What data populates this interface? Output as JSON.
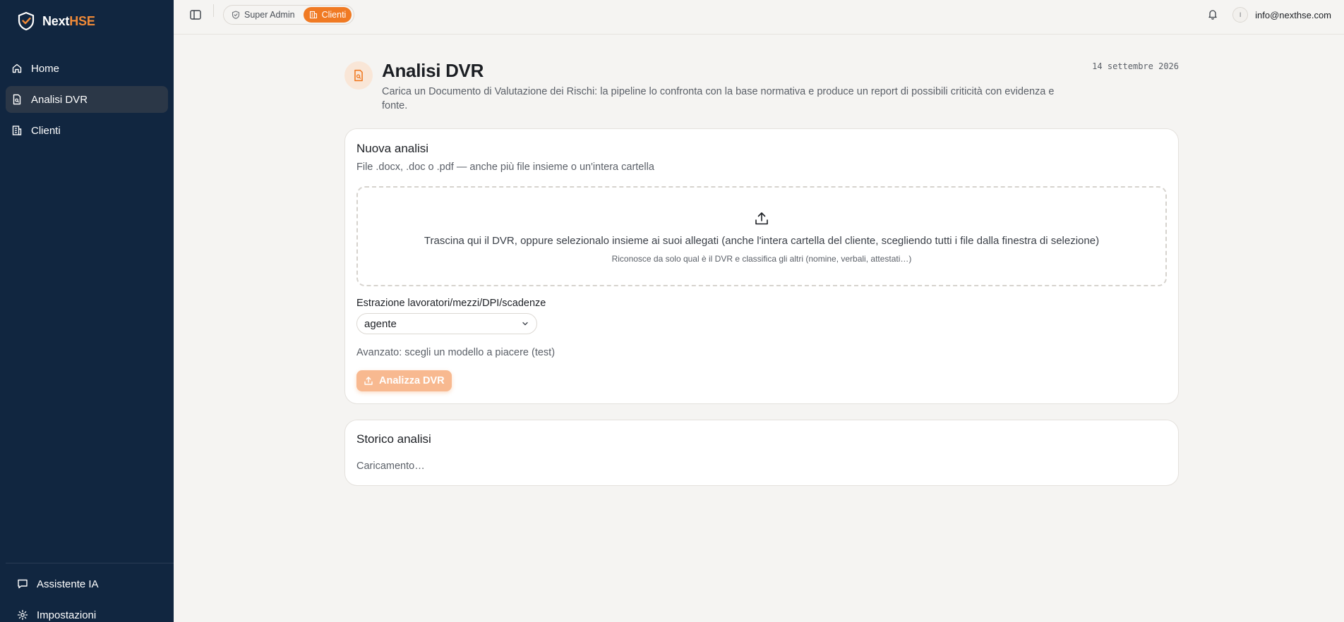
{
  "brand": {
    "name_part1": "Next",
    "name_part2": "HSE"
  },
  "sidebar": {
    "items": [
      {
        "label": "Home",
        "icon": "home-icon"
      },
      {
        "label": "Analisi DVR",
        "icon": "document-icon",
        "active": true
      },
      {
        "label": "Clienti",
        "icon": "building-icon"
      }
    ],
    "bottom_items": [
      {
        "label": "Assistente IA",
        "icon": "chat-icon"
      },
      {
        "label": "Impostazioni",
        "icon": "gear-icon"
      }
    ]
  },
  "topbar": {
    "roles": [
      {
        "label": "Super Admin",
        "icon": "shield-icon"
      },
      {
        "label": "Clienti",
        "icon": "building-icon",
        "active": true
      }
    ],
    "avatar_initial": "I",
    "user_email": "info@nexthse.com"
  },
  "page": {
    "title": "Analisi DVR",
    "description": "Carica un Documento di Valutazione dei Rischi: la pipeline lo confronta con la base normativa e produce un report di possibili criticità con evidenza e fonte.",
    "date": "14 settembre 2026"
  },
  "new_analysis": {
    "title": "Nuova analisi",
    "subtitle": "File .docx, .doc o .pdf — anche più file insieme o un'intera cartella",
    "dropzone_text": "Trascina qui il DVR, oppure selezionalo insieme ai suoi allegati (anche l'intera cartella del cliente, scegliendo tutti i file dalla finestra di selezione)",
    "dropzone_subtext": "Riconosce da solo qual è il DVR e classifica gli altri (nomine, verbali, attestati…)",
    "extraction_label": "Estrazione lavoratori/mezzi/DPI/scadenze",
    "extraction_value": "agente",
    "advanced_link": "Avanzato: scegli un modello a piacere (test)",
    "analyze_button": "Analizza DVR"
  },
  "history": {
    "title": "Storico analisi",
    "status": "Caricamento…"
  },
  "colors": {
    "sidebar_bg": "#112640",
    "accent": "#f07a23",
    "accent_disabled": "#f8b990",
    "page_bg": "#f5f4f2"
  }
}
